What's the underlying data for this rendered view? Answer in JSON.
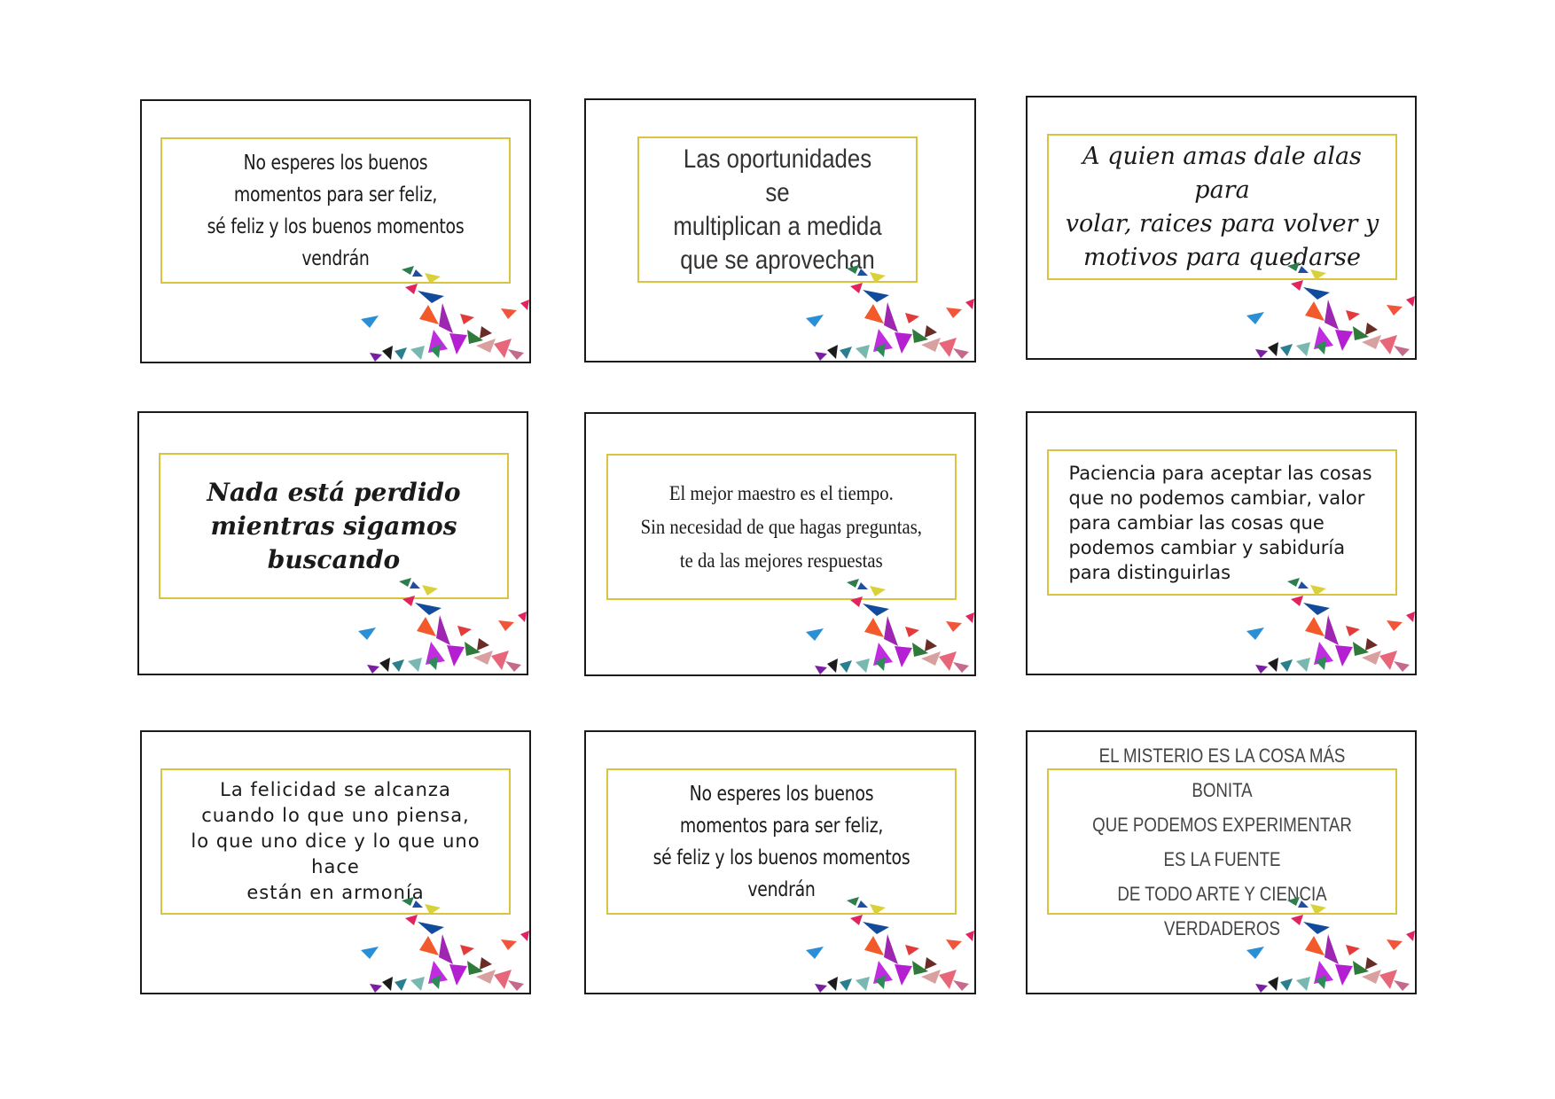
{
  "sheet": {
    "title": ""
  },
  "cards": [
    {
      "quote": "No esperes los buenos momentos para ser feliz,\nsé feliz y los buenos momentos vendrán"
    },
    {
      "quote": "Las oportunidades se\nmultiplican a medida\nque se aprovechan"
    },
    {
      "quote": "A quien amas dale alas para\nvolar, raices para volver y\nmotivos para quedarse"
    },
    {
      "quote": "Nada está perdido\nmientras sigamos buscando"
    },
    {
      "quote": "El mejor maestro es el tiempo.\nSin necesidad de que hagas preguntas,\nte da las mejores respuestas"
    },
    {
      "quote": "Paciencia para aceptar las cosas\nque no podemos cambiar, valor\npara cambiar las cosas que\npodemos cambiar y sabiduría\npara distinguirlas"
    },
    {
      "quote": "La felicidad se alcanza\ncuando lo que uno piensa,\nlo que uno dice y lo que uno hace\nestán en armonía"
    },
    {
      "quote": "No esperes los buenos momentos para ser feliz,\nsé feliz y los buenos momentos vendrán"
    },
    {
      "quote": "EL MISTERIO ES LA COSA MÁS BONITA\nQUE PODEMOS EXPERIMENTAR ES LA FUENTE\nDE TODO ARTE Y CIENCIA VERDADEROS"
    }
  ],
  "colors": {
    "border": "#1a1a1a",
    "frame": "#d9c441"
  }
}
